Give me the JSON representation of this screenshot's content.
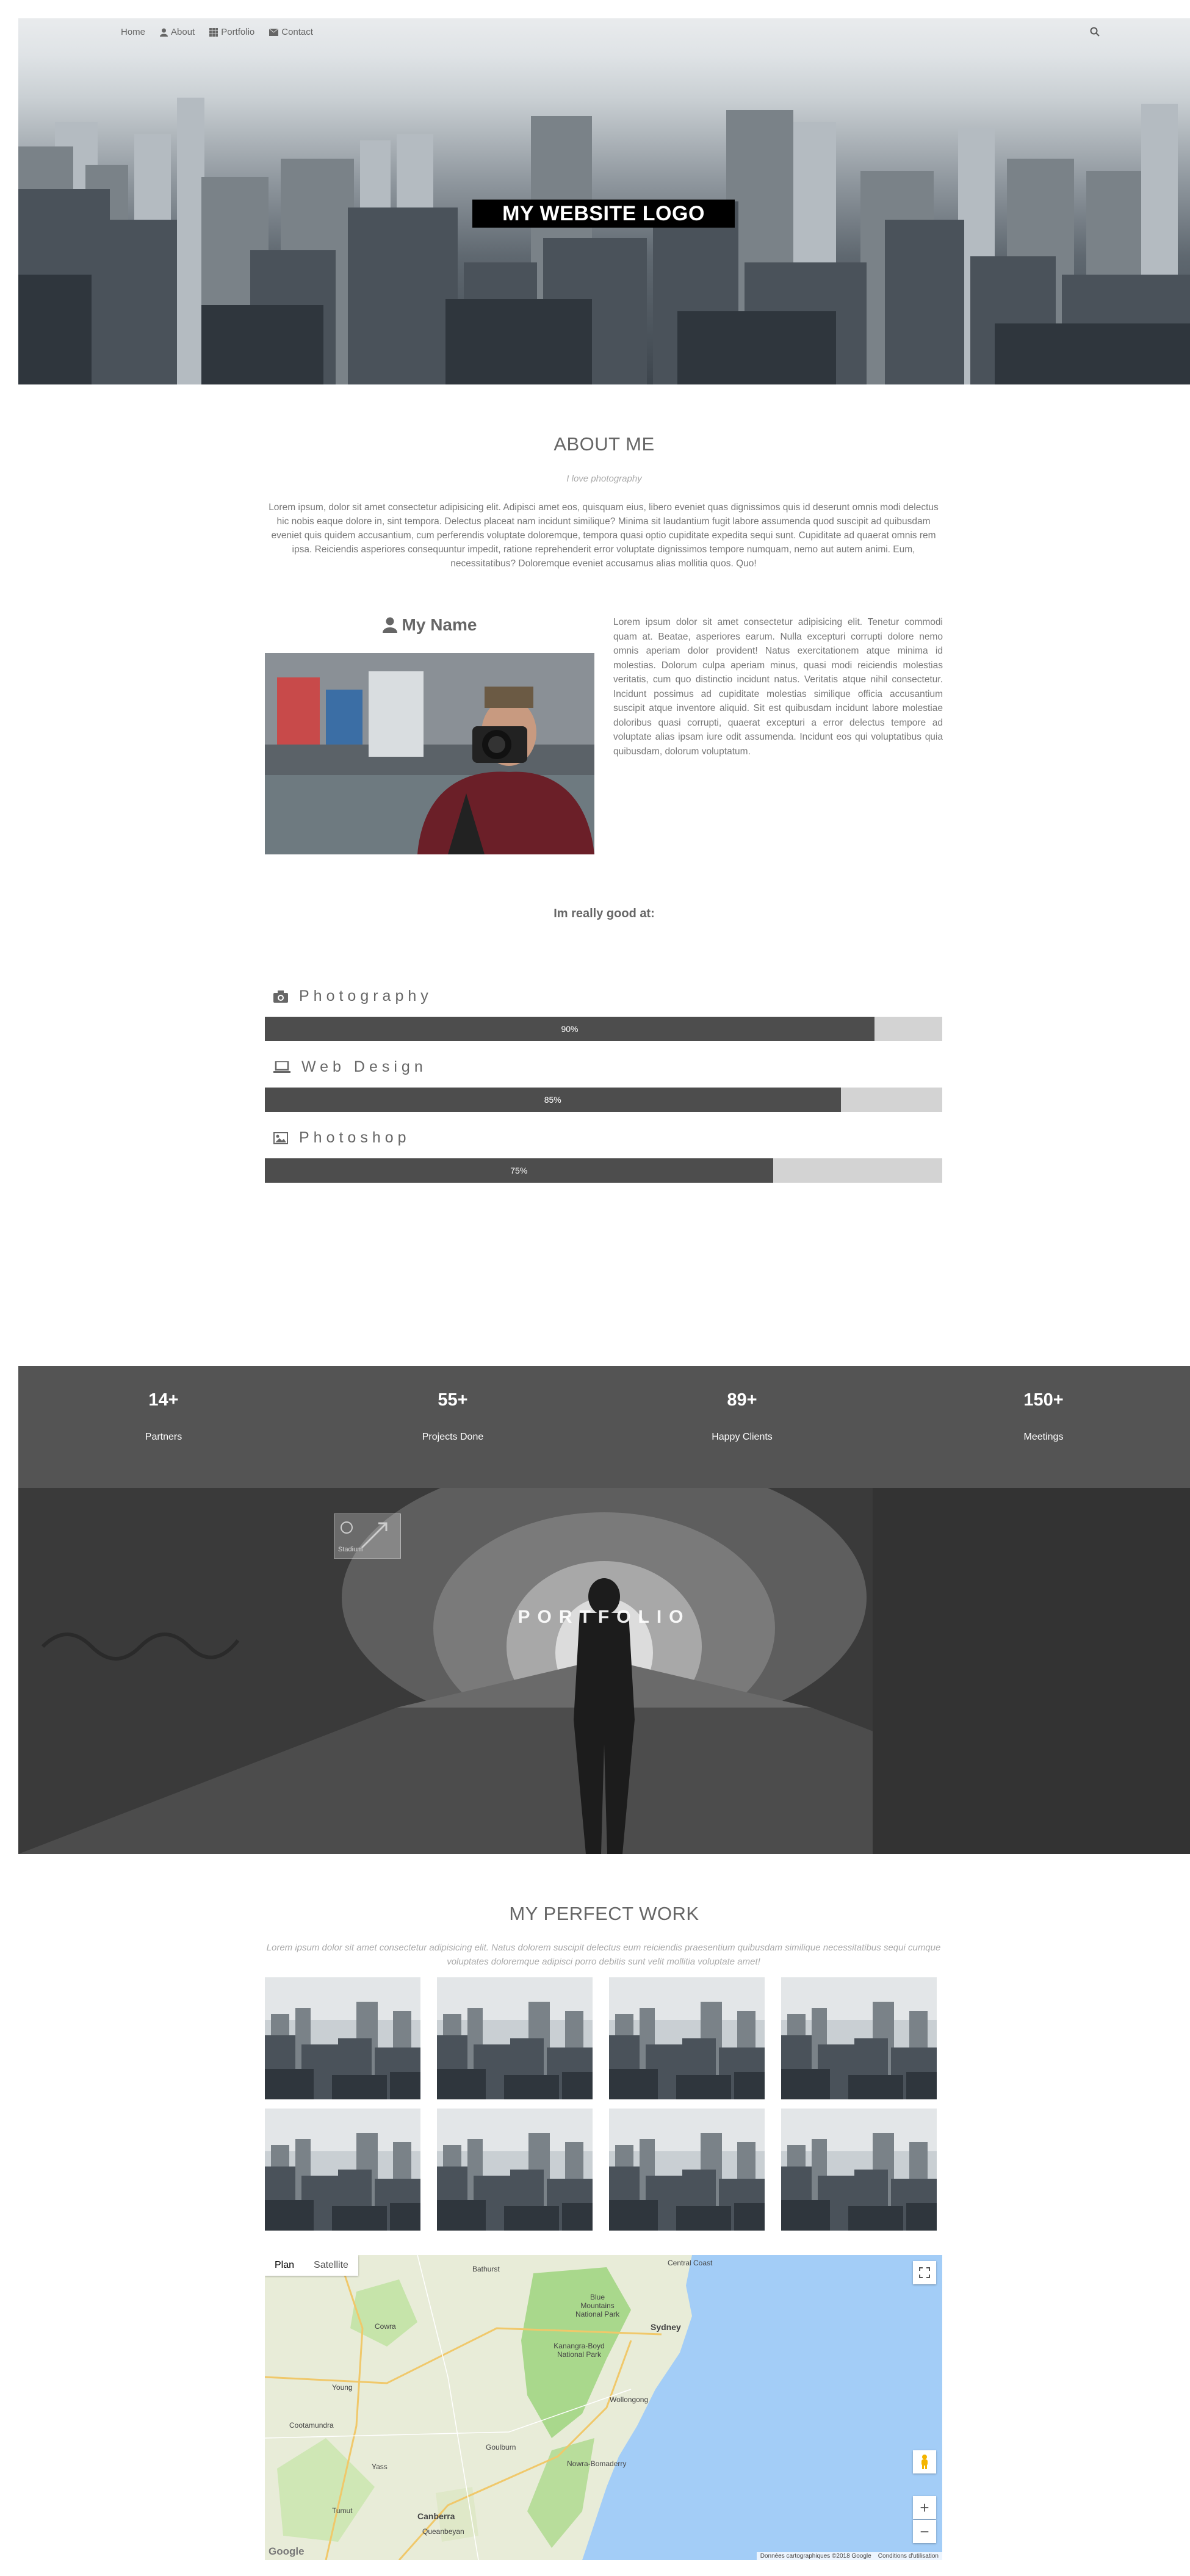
{
  "nav": {
    "items": [
      {
        "label": "Home",
        "icon": "none"
      },
      {
        "label": "About",
        "icon": "user-icon"
      },
      {
        "label": "Portfolio",
        "icon": "grid-icon"
      },
      {
        "label": "Contact",
        "icon": "envelope-icon"
      }
    ],
    "search_icon": "search-icon"
  },
  "hero": {
    "logo": "MY WEBSITE LOGO"
  },
  "about": {
    "title": "ABOUT ME",
    "subtitle": "I love photography",
    "text": "Lorem ipsum, dolor sit amet consectetur adipisicing elit. Adipisci amet eos, quisquam eius, libero eveniet quas dignissimos quis id deserunt omnis modi delectus hic nobis eaque dolore in, sint tempora. Delectus placeat nam incidunt similique? Minima sit laudantium fugit labore assumenda quod suscipit ad quibusdam eveniet quis quidem accusantium, cum perferendis voluptate doloremque, tempora quasi optio cupiditate expedita sequi sunt. Cupiditate ad quaerat omnis rem ipsa. Reiciendis asperiores consequuntur impedit, ratione reprehenderit error voluptate dignissimos tempore numquam, nemo aut autem animi. Eum, necessitatibus? Doloremque eveniet accusamus alias mollitia quos. Quo!",
    "name": "My Name",
    "bio": "Lorem ipsum dolor sit amet consectetur adipisicing elit. Tenetur commodi quam at. Beatae, asperiores earum. Nulla excepturi corrupti dolore nemo omnis aperiam dolor provident! Natus exercitationem atque minima id molestias. Dolorum culpa aperiam minus, quasi modi reiciendis molestias veritatis, cum quo distinctio incidunt natus. Veritatis atque nihil consectetur. Incidunt possimus ad cupiditate molestias similique officia accusantium suscipit atque inventore aliquid. Sit est quibusdam incidunt labore molestiae doloribus quasi corrupti, quaerat excepturi a error delectus tempore ad voluptate alias ipsam iure odit assumenda. Incidunt eos qui voluptatibus quia quibusdam, dolorum voluptatum."
  },
  "skills": {
    "heading": "Im really good at:",
    "items": [
      {
        "label": "Photography",
        "icon": "camera-icon",
        "percent": 90,
        "percent_label": "90%"
      },
      {
        "label": "Web Design",
        "icon": "laptop-icon",
        "percent": 85,
        "percent_label": "85%"
      },
      {
        "label": "Photoshop",
        "icon": "image-icon",
        "percent": 75,
        "percent_label": "75%"
      }
    ]
  },
  "counters": [
    {
      "number": "14+",
      "label": "Partners"
    },
    {
      "number": "55+",
      "label": "Projects Done"
    },
    {
      "number": "89+",
      "label": "Happy Clients"
    },
    {
      "number": "150+",
      "label": "Meetings"
    }
  ],
  "portfolio": {
    "title": "PORTFOLIO",
    "mini_label": "Stadium"
  },
  "work": {
    "title": "MY PERFECT WORK",
    "subtitle": "Lorem ipsum dolor sit amet consectetur adipisicing elit. Natus dolorem suscipit delectus eum reiciendis praesentium quibusdam similique necessitatibus sequi cumque voluptates doloremque adipisci porro debitis sunt velit mollitia voluptate amet!",
    "thumb_count": 8
  },
  "map": {
    "tab_plan": "Plan",
    "tab_satellite": "Satellite",
    "places": [
      "Central Coast",
      "Bathurst",
      "Blue Mountains National Park",
      "Sydney",
      "Kanangra-Boyd National Park",
      "Wollongong",
      "Goulburn",
      "Nowra-Bomaderry",
      "Canberra",
      "Queanbeyan",
      "Young",
      "Cootamundra",
      "Yass",
      "Cowra",
      "Tumut"
    ],
    "zoom_in": "+",
    "zoom_out": "−",
    "attribution_data": "Données cartographiques ©2018 Google",
    "attribution_terms": "Conditions d'utilisation",
    "google": "Google"
  },
  "colors": {
    "bar_fill": "#4d4d4d",
    "bar_track": "#d3d3d3",
    "counter_bg": "#545454",
    "logo_bg": "#000000"
  }
}
